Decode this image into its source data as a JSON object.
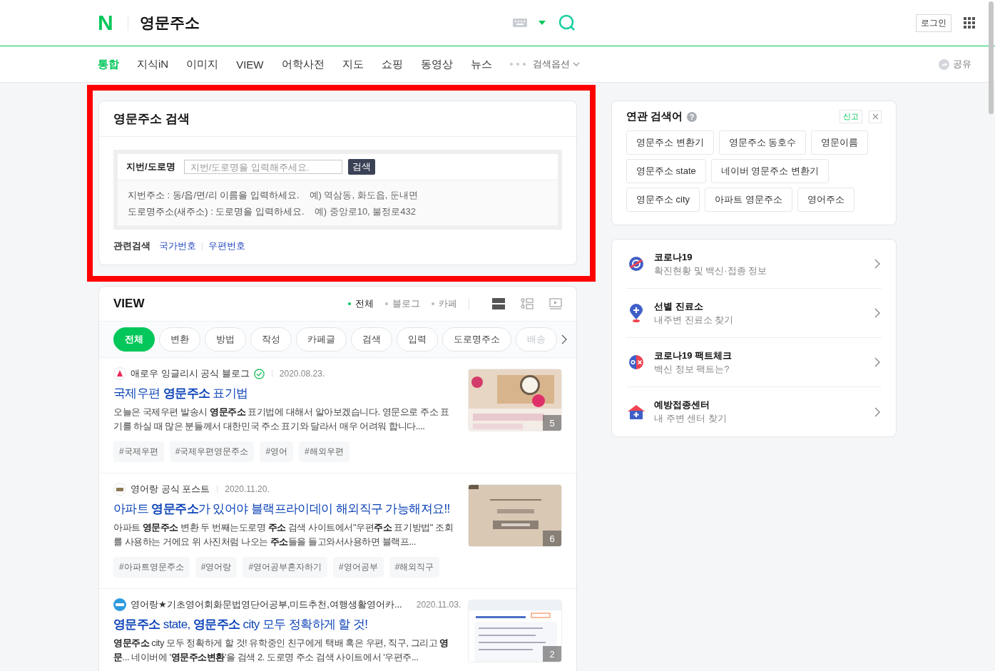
{
  "header": {
    "logo": "N",
    "query": "영문주소",
    "login": "로그인"
  },
  "tabs": [
    {
      "label": "통합",
      "selected": true
    },
    {
      "label": "지식iN",
      "selected": false
    },
    {
      "label": "이미지",
      "selected": false
    },
    {
      "label": "VIEW",
      "selected": false
    },
    {
      "label": "어학사전",
      "selected": false
    },
    {
      "label": "지도",
      "selected": false
    },
    {
      "label": "쇼핑",
      "selected": false
    },
    {
      "label": "동영상",
      "selected": false
    },
    {
      "label": "뉴스",
      "selected": false
    }
  ],
  "search_options": "검색옵션",
  "share": "공유",
  "address_search": {
    "highlighted": true,
    "title": "영문주소 검색",
    "field_label": "지번/도로명",
    "placeholder": "지번/도로명을 입력해주세요.",
    "button": "검색",
    "hints": [
      {
        "text": "지번주소 : 동/읍/면/리 이름을 입력하세요.",
        "example": "예) 역삼동, 화도읍, 둔내면"
      },
      {
        "text": "도로명주소(새주소) : 도로명을 입력하세요.",
        "example": "예) 중앙로10, 불정로432"
      }
    ],
    "related_label": "관련검색",
    "related_links": [
      "국가번호",
      "우편번호"
    ]
  },
  "view": {
    "title": "VIEW",
    "filters": [
      {
        "label": "전체",
        "selected": true
      },
      {
        "label": "블로그",
        "selected": false
      },
      {
        "label": "카페",
        "selected": false
      }
    ],
    "layout_modes": [
      {
        "kind": "list",
        "selected": true
      },
      {
        "kind": "detail",
        "selected": false
      },
      {
        "kind": "video",
        "selected": false
      }
    ],
    "chips": [
      {
        "label": "전체",
        "selected": true
      },
      {
        "label": "변환",
        "selected": false
      },
      {
        "label": "방법",
        "selected": false
      },
      {
        "label": "작성",
        "selected": false
      },
      {
        "label": "카페글",
        "selected": false
      },
      {
        "label": "검색",
        "selected": false
      },
      {
        "label": "입력",
        "selected": false
      },
      {
        "label": "도로명주소",
        "selected": false
      },
      {
        "label": "배송",
        "selected": false
      }
    ],
    "posts": [
      {
        "source": "애로우 잉글리시 공식 블로그",
        "verified": true,
        "date": "2020.08.23.",
        "title": "국제우편 **영문주소** 표기법",
        "snippet": "오늘은 국제우편 발송시 **영문주소** 표기법에 대해서 알아보겠습니다. 영문으로 주소 표기를 하실 때 많은 분들께서 대한민국 주소 표기와 달라서 매우 어려워 합니다....",
        "tags": [
          "#국제우편",
          "#국제우편영문주소",
          "#영어",
          "#해외우편"
        ],
        "thumbnail": {
          "kind": "picture",
          "count": "5"
        }
      },
      {
        "source": "영어랑 공식 포스트",
        "verified": false,
        "date": "2020.11.20.",
        "title": "아파트 **영문주소**가 있어야 블랙프라이데이 해외직구 가능해져요!!",
        "snippet": "아파트 **영문주소** 변환 두 번째는도로명 **주소** 검색 사이트에서\"우편**주소** 표기방법\" 조회를 사용하는 거에요 위 사진처럼 나오는 **주소**들을 들고와서사용하면 블랙프...",
        "tags": [
          "#아파트영문주소",
          "#영어랑",
          "#영어공부혼자하기",
          "#영어공부",
          "#해외직구"
        ],
        "thumbnail": {
          "kind": "picture",
          "count": "6"
        }
      },
      {
        "source": "영어랑★기초영어회화문법영단어공부,미드추천,여행생활영어카...",
        "verified": false,
        "date": "2020.11.03.",
        "title": "**영문주소** state, **영문주소** city 모두 정확하게 할 것!",
        "snippet": "**영문주소** city 모두 정확하게 할 것! 유학중인 친구에게 택배 혹은 우편, 직구, 그리고 **영문**... 네이버에 '**영문주소변환**'을 검색 2. 도로명 주소 검색 사이트에서 '우편주...",
        "thumbnail": {
          "kind": "picture",
          "count": "2"
        }
      }
    ]
  },
  "related": {
    "title": "연관 검색어",
    "help": "?",
    "report": "신고",
    "terms": [
      "영문주소 변환기",
      "영문주소 동호수",
      "영문이름",
      "영문주소 state",
      "네이버 영문주소 변환기",
      "영문주소 city",
      "아파트 영문주소",
      "영어주소"
    ]
  },
  "covid": [
    {
      "kind": "virus",
      "title": "코로나19",
      "subtitle": "확진현황 및 백신·접종 정보"
    },
    {
      "kind": "pin",
      "title": "선별 진료소",
      "subtitle": "내주변 진료소 찾기"
    },
    {
      "kind": "ox",
      "title": "코로나19 팩트체크",
      "subtitle": "백신 정보 팩트는?"
    },
    {
      "kind": "house",
      "title": "예방접종센터",
      "subtitle": "내 주변 센터 찾기"
    }
  ]
}
